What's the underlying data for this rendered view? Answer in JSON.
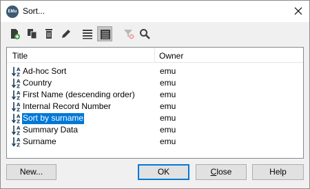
{
  "window": {
    "title": "Sort...",
    "app_icon_text": "EMu"
  },
  "toolbar": {
    "buttons": [
      {
        "name": "new-sort-icon"
      },
      {
        "name": "copy-icon"
      },
      {
        "name": "delete-icon"
      },
      {
        "name": "edit-icon"
      },
      {
        "name": "list-view-icon"
      },
      {
        "name": "details-view-icon",
        "active": true
      },
      {
        "name": "filter-clear-icon",
        "disabled": true
      },
      {
        "name": "search-icon"
      }
    ]
  },
  "list": {
    "headers": {
      "title": "Title",
      "owner": "Owner"
    },
    "rows": [
      {
        "title": "Ad-hoc Sort",
        "owner": "emu"
      },
      {
        "title": "Country",
        "owner": "emu"
      },
      {
        "title": "First Name (descending order)",
        "owner": "emu"
      },
      {
        "title": "Internal Record Number",
        "owner": "emu"
      },
      {
        "title": "Sort by surname",
        "owner": "emu",
        "selected": true
      },
      {
        "title": "Summary Data",
        "owner": "emu"
      },
      {
        "title": "Surname",
        "owner": "emu"
      }
    ]
  },
  "buttons": {
    "new": "New...",
    "ok": "OK",
    "close_first": "C",
    "close_rest": "lose",
    "help": "Help"
  },
  "colors": {
    "selection": "#0078d7",
    "default_button_border": "#0078d7"
  }
}
